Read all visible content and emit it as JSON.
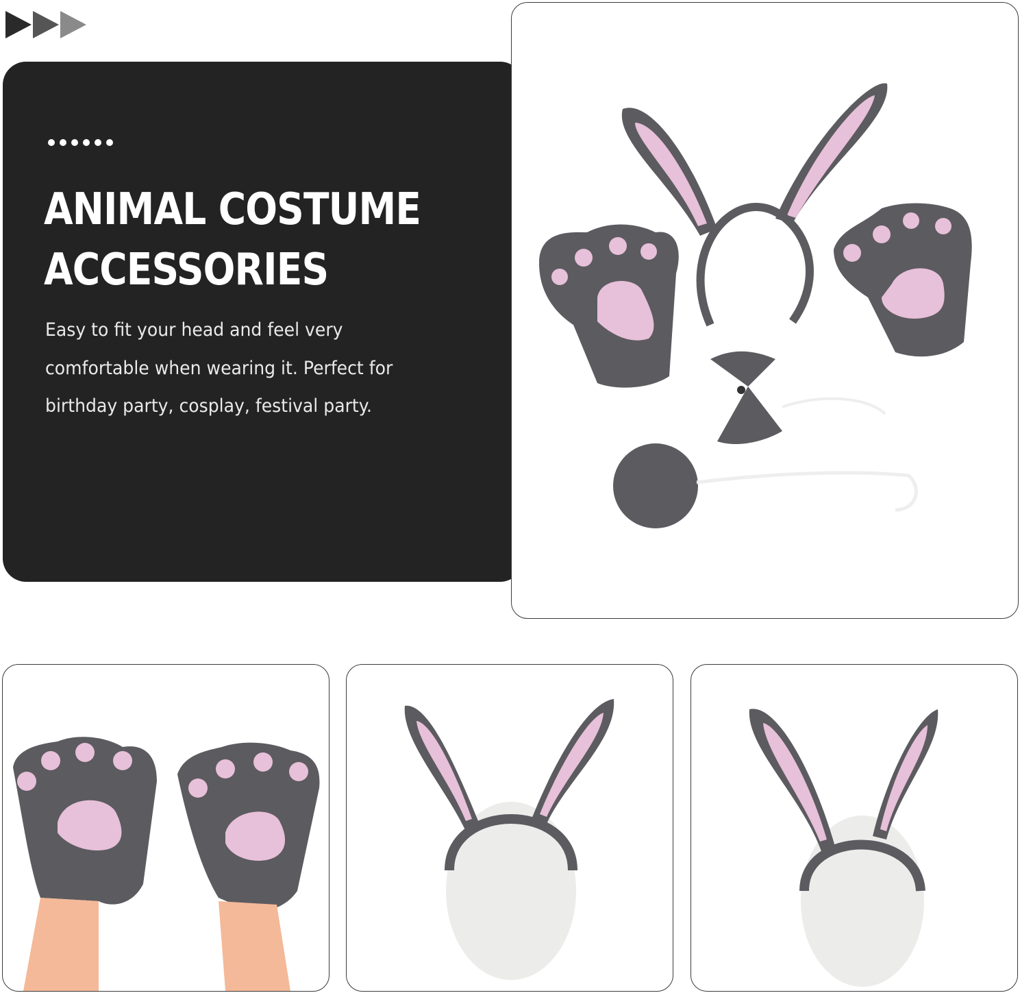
{
  "header": {
    "arrows_icon": "triple-play-arrows"
  },
  "info_panel": {
    "dots_icon": "dotted-divider",
    "title_line1": "ANIMAL COSTUME",
    "title_line2": "ACCESSORIES",
    "description": "Easy to fit your head and feel very comfortable when wearing it. Perfect for birthday party, cosplay, festival party."
  },
  "colors": {
    "panel_bg": "#232323",
    "plush_grey": "#5c5b60",
    "pad_pink": "#e7c0d9",
    "frame_border": "#3a3a3a"
  }
}
